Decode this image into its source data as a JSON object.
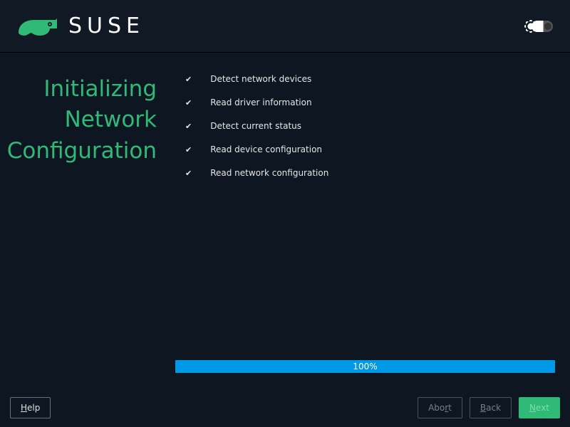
{
  "brand": "SUSE",
  "page_title_lines": [
    "Initializing",
    "Network",
    "Configuration"
  ],
  "steps": [
    {
      "done": true,
      "label": "Detect network devices"
    },
    {
      "done": true,
      "label": "Read driver information"
    },
    {
      "done": true,
      "label": "Detect current status"
    },
    {
      "done": true,
      "label": "Read device configuration"
    },
    {
      "done": true,
      "label": "Read network configuration"
    }
  ],
  "progress": {
    "percent": 100,
    "label": "100%"
  },
  "buttons": {
    "help": {
      "label": "Help",
      "mnemonic_index": 0,
      "enabled": true
    },
    "abort": {
      "label": "Abort",
      "mnemonic_index": 3,
      "enabled": false
    },
    "back": {
      "label": "Back",
      "mnemonic_index": 0,
      "enabled": false
    },
    "next": {
      "label": "Next",
      "mnemonic_index": 0,
      "enabled": false
    }
  },
  "icons": {
    "check": "✔"
  }
}
